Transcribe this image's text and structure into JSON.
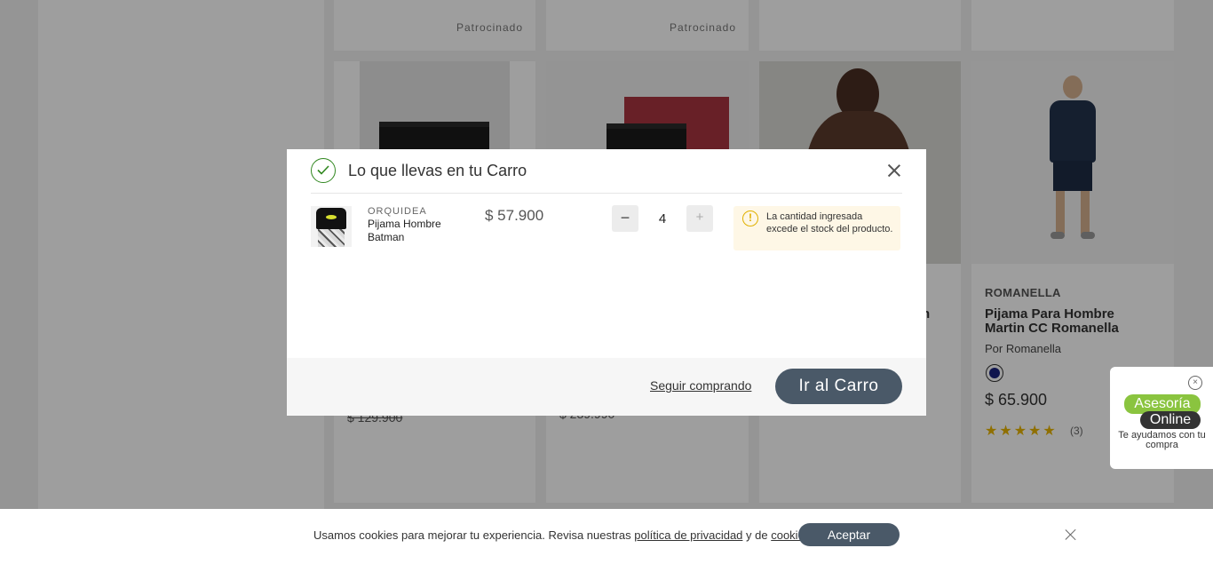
{
  "background": {
    "sponsored_label_1": "Patrocinado",
    "sponsored_label_2": "Patrocinado",
    "product_1": {
      "old_price": "$ 129.900"
    },
    "product_2": {
      "old_price": "$ 239.990"
    },
    "product_3": {
      "name_fragment": "n"
    },
    "product_4": {
      "brand": "ROMANELLA",
      "name": "Pijama Para Hombre Martin CC Romanella",
      "seller": "Por Romanella",
      "price": "$ 65.900",
      "rating": 5,
      "stars": "★★★★★",
      "reviews": "(3)",
      "swatch_color": "#1a237e"
    }
  },
  "modal": {
    "title": "Lo que llevas en tu Carro",
    "item": {
      "brand": "ORQUIDEA",
      "name": "Pijama Hombre Batman",
      "price": "$ 57.900",
      "quantity": "4",
      "minus_label": "−",
      "plus_label": "+",
      "warning_icon": "!",
      "warning": "La cantidad ingresada excede el stock del producto."
    },
    "keep_shopping": "Seguir comprando",
    "go_to_cart": "Ir al Carro"
  },
  "chat": {
    "close": "×",
    "line1": "Asesoría",
    "line2": "Online",
    "subtitle": "Te ayudamos con tu compra"
  },
  "cookies": {
    "text_before": "Usamos cookies para mejorar tu experiencia. Revisa nuestras ",
    "privacy_link": "política de privacidad",
    "text_middle": " y de ",
    "cookies_link": "cookies",
    "text_after": ".",
    "accept": "Aceptar"
  },
  "colors": {
    "primary_button": "#4a5968",
    "success": "#30871f",
    "warning": "#e0b000",
    "warning_bg": "#fef7e6"
  }
}
